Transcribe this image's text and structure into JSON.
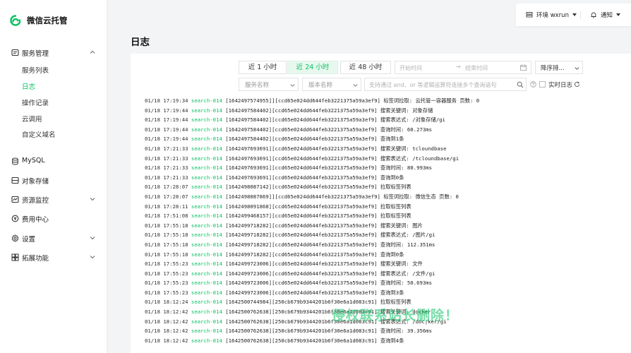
{
  "app": {
    "name": "微信云托管",
    "brand_color": "#07c160"
  },
  "header": {
    "env_label": "环境 wxrun",
    "notify_label": "通知"
  },
  "sidebar": {
    "groups": [
      {
        "label": "服务管理",
        "icon": "service-icon",
        "expanded": true,
        "items": [
          {
            "label": "服务列表",
            "active": false
          },
          {
            "label": "日志",
            "active": true
          },
          {
            "label": "操作记录",
            "active": false
          },
          {
            "label": "云调用",
            "active": false
          },
          {
            "label": "自定义域名",
            "active": false
          }
        ]
      },
      {
        "label": "MySQL",
        "icon": "database-icon"
      },
      {
        "label": "对象存储",
        "icon": "storage-icon"
      },
      {
        "label": "资源监控",
        "icon": "monitor-icon",
        "expanded": false
      },
      {
        "label": "费用中心",
        "icon": "billing-icon"
      },
      {
        "label": "设置",
        "icon": "gear-icon",
        "expanded": false
      },
      {
        "label": "拓展功能",
        "icon": "extension-icon",
        "expanded": false
      }
    ]
  },
  "page": {
    "title": "日志"
  },
  "toolbar": {
    "tabs": [
      "近 1 小时",
      "近 24 小时",
      "近 48 小时"
    ],
    "active_tab": 1,
    "start_placeholder": "开始时间",
    "end_placeholder": "结束时间",
    "sort_label": "降序排...",
    "service_filter": "服务名称",
    "version_filter": "版本名称",
    "query_placeholder": "支持通过 and、or 等逻辑运算符连接多个查询语句",
    "realtime_label": "实时日志"
  },
  "logs": [
    {
      "ts": "01/18 17:19:34",
      "svc": "search-014",
      "msg": "[1642497574955]][ccd65e024dd644feb3221375a59a3ef9] 标签词拉取: 云托管一容器服务 页数: 0"
    },
    {
      "ts": "01/18 17:19:44",
      "svc": "search-014",
      "msg": "[1642497584402][ccd65e024dd644feb3221375a59a3ef9] 搜索关键词: 对象存储"
    },
    {
      "ts": "01/18 17:19:44",
      "svc": "search-014",
      "msg": "[1642497584402][ccd65e024dd644feb3221375a59a3ef9] 搜索表达式: /对象存储/gi"
    },
    {
      "ts": "01/18 17:19:44",
      "svc": "search-014",
      "msg": "[1642497584402][ccd65e024dd644feb3221375a59a3ef9] 查询时间: 60.273ms"
    },
    {
      "ts": "01/18 17:19:44",
      "svc": "search-014",
      "msg": "[1642497584402][ccd65e024dd644feb3221375a59a3ef9] 查询到1条"
    },
    {
      "ts": "01/18 17:21:33",
      "svc": "search-014",
      "msg": "[1642497693691][ccd65e024dd644feb3221375a59a3ef9] 搜索关键词: tcloundbase"
    },
    {
      "ts": "01/18 17:21:33",
      "svc": "search-014",
      "msg": "[1642497693691][ccd65e024dd644feb3221375a59a3ef9] 搜索表达式: /tcloundbase/gi"
    },
    {
      "ts": "01/18 17:21:33",
      "svc": "search-014",
      "msg": "[1642497693691][ccd65e024dd644feb3221375a59a3ef9] 查询时间: 80.993ms"
    },
    {
      "ts": "01/18 17:21:33",
      "svc": "search-014",
      "msg": "[1642497693691][ccd65e024dd644feb3221375a59a3ef9] 查询到0条"
    },
    {
      "ts": "01/18 17:28:07",
      "svc": "search-014",
      "msg": "[1642498087142][ccd65e024dd644feb3221375a59a3ef9] 拉取标签列表"
    },
    {
      "ts": "01/18 17:28:07",
      "svc": "search-014",
      "msg": "[1642498087869]][ccd65e024dd644feb3221375a59a3ef9] 标签词拉取: 微信生态 页数: 0"
    },
    {
      "ts": "01/18 17:28:11",
      "svc": "search-014",
      "msg": "[1642498091868][ccd65e024dd644feb3221375a59a3ef9] 拉取标签列表"
    },
    {
      "ts": "01/18 17:51:08",
      "svc": "search-014",
      "msg": "[1642499468157][ccd65e024dd644feb3221375a59a3ef9] 拉取标签列表"
    },
    {
      "ts": "01/18 17:55:18",
      "svc": "search-014",
      "msg": "[1642499718282][ccd65e024dd644feb3221375a59a3ef9] 搜索关键词: 图片"
    },
    {
      "ts": "01/18 17:55:18",
      "svc": "search-014",
      "msg": "[1642499718282][ccd65e024dd644feb3221375a59a3ef9] 搜索表达式: /图片/gi"
    },
    {
      "ts": "01/18 17:55:18",
      "svc": "search-014",
      "msg": "[1642499718282][ccd65e024dd644feb3221375a59a3ef9] 查询时间: 112.351ms"
    },
    {
      "ts": "01/18 17:55:18",
      "svc": "search-014",
      "msg": "[1642499718282][ccd65e024dd644feb3221375a59a3ef9] 查询到0条"
    },
    {
      "ts": "01/18 17:55:23",
      "svc": "search-014",
      "msg": "[1642499723006][ccd65e024dd644feb3221375a59a3ef9] 搜索关键词: 文件"
    },
    {
      "ts": "01/18 17:55:23",
      "svc": "search-014",
      "msg": "[1642499723006][ccd65e024dd644feb3221375a59a3ef9] 搜索表达式: /文件/gi"
    },
    {
      "ts": "01/18 17:55:23",
      "svc": "search-014",
      "msg": "[1642499723006][ccd65e024dd644feb3221375a59a3ef9] 查询时间: 50.693ms"
    },
    {
      "ts": "01/18 17:55:23",
      "svc": "search-014",
      "msg": "[1642499723006][ccd65e024dd644feb3221375a59a3ef9] 查询到3条"
    },
    {
      "ts": "01/18 18:12:24",
      "svc": "search-014",
      "msg": "[1642500744984][250cb679b9344201b6f30e6a1d083c91] 拉取标签列表"
    },
    {
      "ts": "01/18 18:12:42",
      "svc": "search-014",
      "msg": "[1642500762638][250cb679b9344201b6f30e6a1d083c91] 搜索关键词: docker"
    },
    {
      "ts": "01/18 18:12:42",
      "svc": "search-014",
      "msg": "[1642500762638][250cb679b9344201b6f30e6a1d083c91] 搜索表达式: /doc|ker/gi"
    },
    {
      "ts": "01/18 18:12:42",
      "svc": "search-014",
      "msg": "[1642500762638][250cb679b9344201b6f30e6a1d083c91] 查询时间: 39.356ms"
    },
    {
      "ts": "01/18 18:12:42",
      "svc": "search-014",
      "msg": "[1642500762638][250cb679b9344201b6f30e6a1d083c91] 查询到4条"
    }
  ],
  "watermark": "侵权联系站长删除！"
}
